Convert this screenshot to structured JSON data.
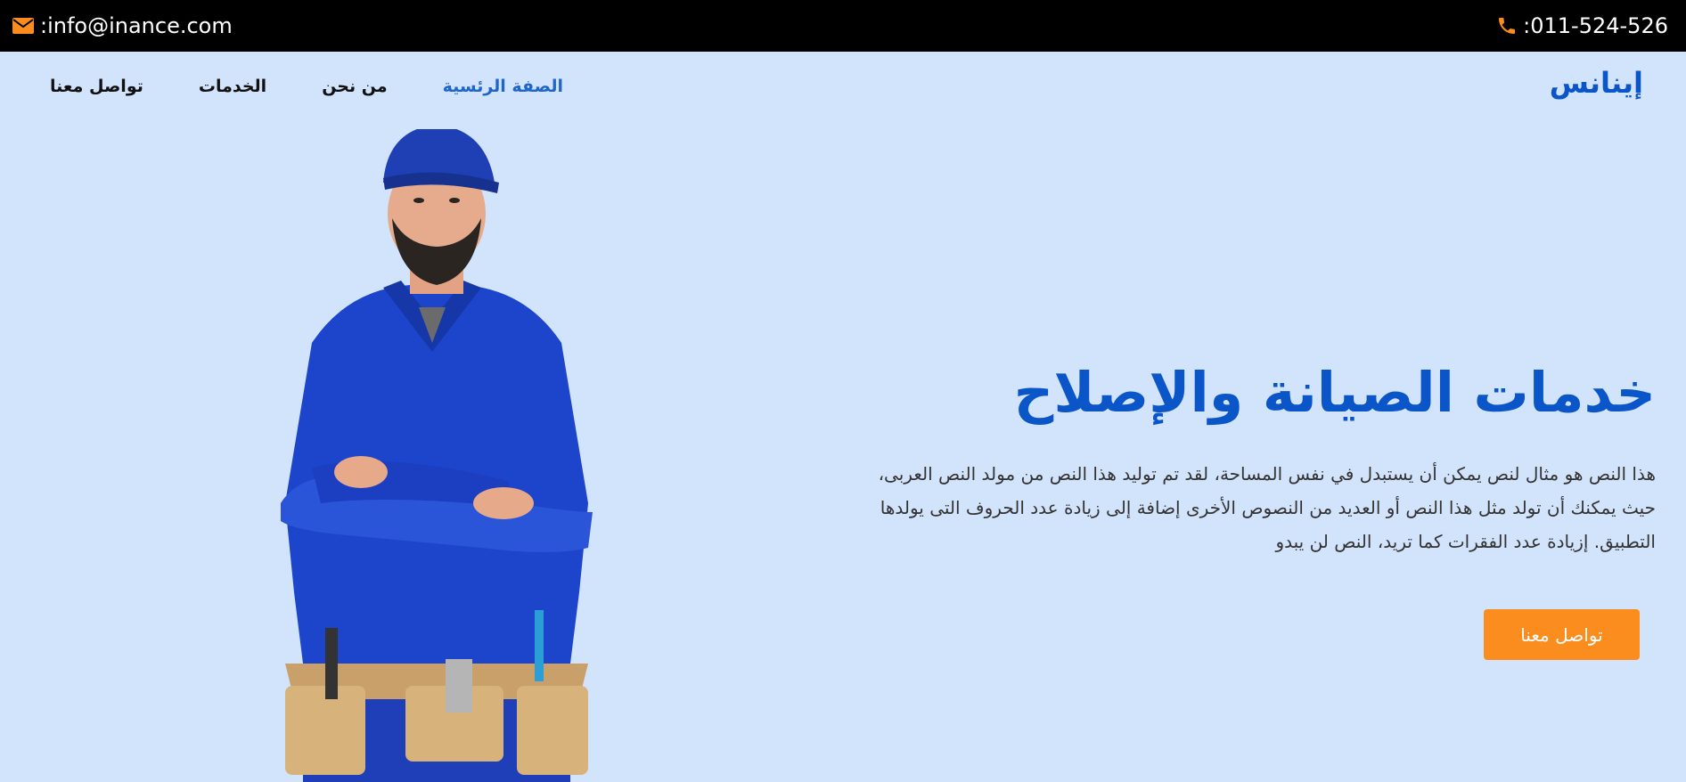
{
  "topbar": {
    "phone": ":011-524-526",
    "email": ":info@inance.com",
    "phone_icon": "phone-icon",
    "email_icon": "envelope-icon",
    "icon_color": "#fb8c1e"
  },
  "brand": {
    "name": "إينانس"
  },
  "nav": {
    "items": [
      {
        "label": "الصفة الرئسية",
        "active": true
      },
      {
        "label": "من نحن",
        "active": false
      },
      {
        "label": "الخدمات",
        "active": false
      },
      {
        "label": "تواصل معنا",
        "active": false
      }
    ]
  },
  "hero": {
    "title": "خدمات الصيانة والإصلاح",
    "description": "هذا النص هو مثال لنص يمكن أن يستبدل في نفس المساحة، لقد تم توليد هذا النص من مولد النص العربى، حيث يمكنك أن تولد مثل هذا النص أو العديد من النصوص الأخرى إضافة إلى زيادة عدد الحروف التى يولدها التطبيق. إزيادة عدد الفقرات كما تريد، النص لن يبدو",
    "cta_label": "تواصل معنا",
    "image": "repairman-worker-illustration"
  },
  "colors": {
    "background": "#d2e3fc",
    "topbar": "#000000",
    "brand_blue": "#0a56c9",
    "accent_orange": "#fb8c1e"
  }
}
